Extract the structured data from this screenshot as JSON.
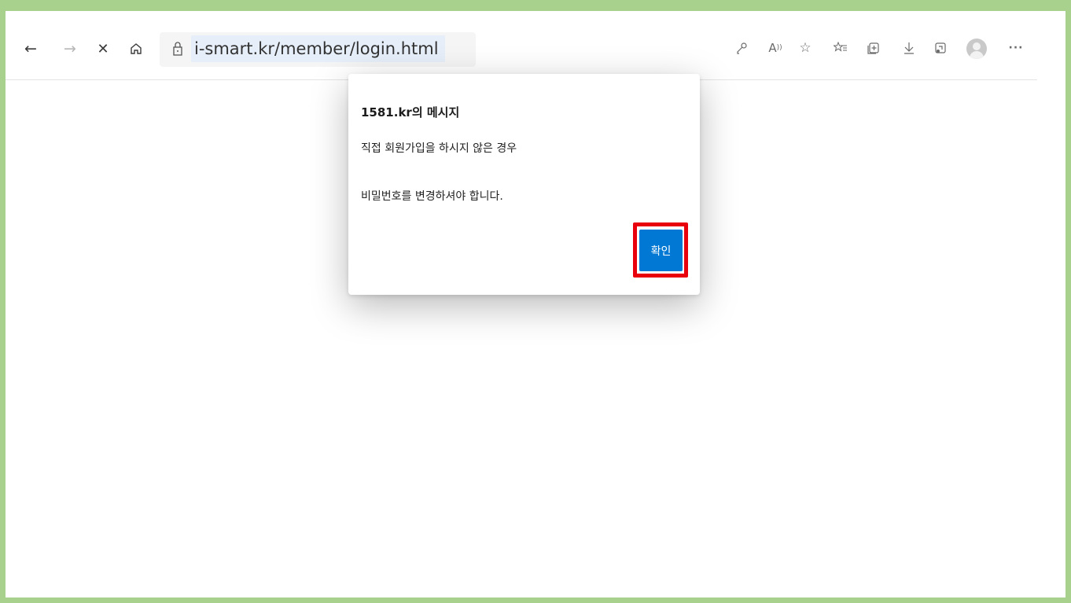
{
  "browser": {
    "url": "i-smart.kr/member/login.html",
    "nav_icons": [
      "back-arrow-icon",
      "forward-arrow-icon",
      "stop-icon",
      "home-icon"
    ],
    "toolbar_icons": [
      "key-icon",
      "read-aloud-icon",
      "add-favorite-icon",
      "favorites-icon",
      "collections-icon",
      "download-icon",
      "extensions-icon",
      "profile-avatar",
      "more-icon"
    ]
  },
  "dialog": {
    "title": "1581.kr의 메시지",
    "line1": "직접 회원가입을 하시지 않은 경우",
    "line2": "비밀번호를 변경하셔야 합니다.",
    "ok_label": "확인",
    "highlight_color": "#e8000c",
    "button_color": "#0078d4"
  },
  "frame_color": "#a9d18e"
}
